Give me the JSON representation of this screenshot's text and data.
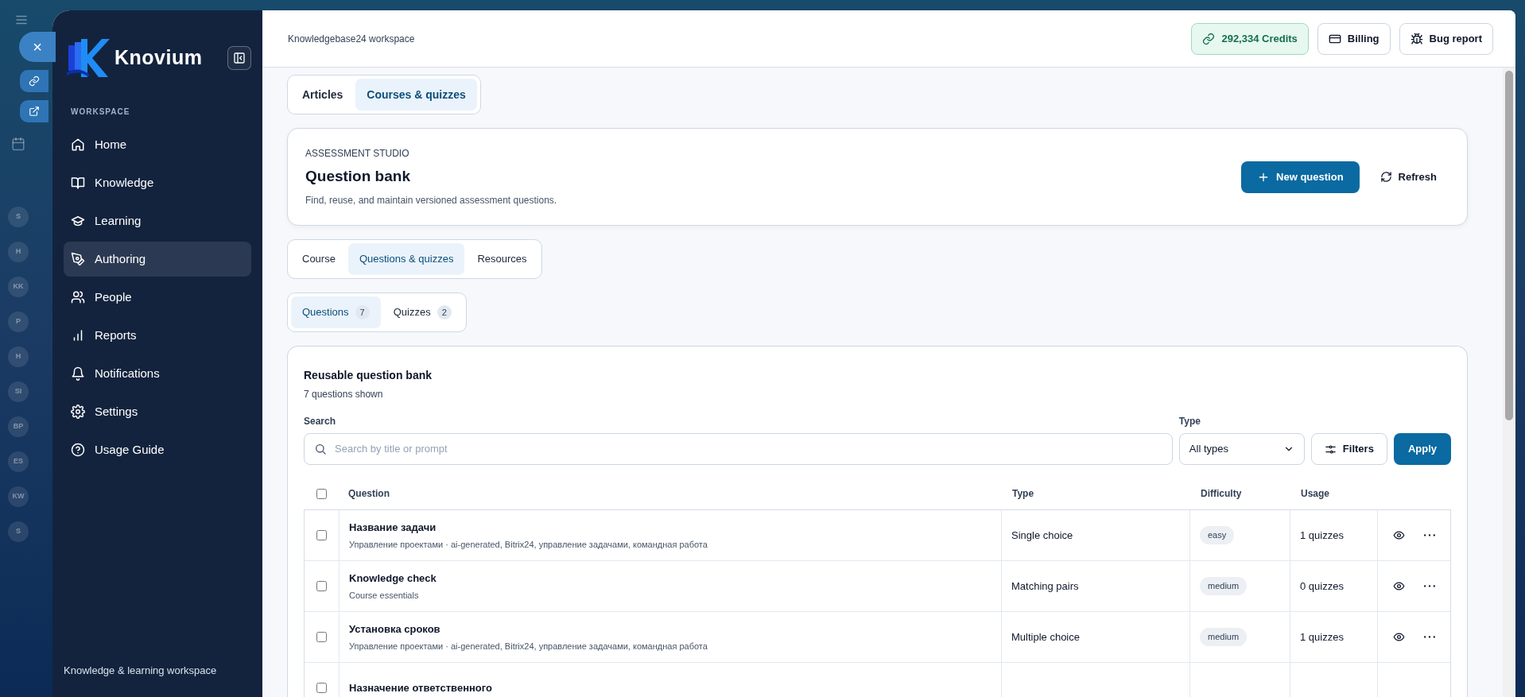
{
  "side_strip": {
    "close": "×",
    "avatars": [
      "S",
      "H",
      "KK",
      "P",
      "H",
      "SI",
      "BP",
      "ES",
      "KW",
      "S"
    ]
  },
  "sidebar": {
    "brand": "Knovium",
    "section": "WORKSPACE",
    "items": [
      {
        "label": "Home",
        "selected": false
      },
      {
        "label": "Knowledge",
        "selected": false
      },
      {
        "label": "Learning",
        "selected": false
      },
      {
        "label": "Authoring",
        "selected": true
      },
      {
        "label": "People",
        "selected": false
      },
      {
        "label": "Reports",
        "selected": false
      },
      {
        "label": "Notifications",
        "selected": false
      },
      {
        "label": "Settings",
        "selected": false
      },
      {
        "label": "Usage Guide",
        "selected": false
      }
    ],
    "footer": "Knowledge & learning workspace"
  },
  "header": {
    "workspace": "Knowledgebase24 workspace",
    "actions": [
      {
        "kind": "credits",
        "label": "292,334 Credits"
      },
      {
        "kind": "billing",
        "label": "Billing"
      },
      {
        "kind": "bug",
        "label": "Bug report"
      }
    ]
  },
  "top_tabs": [
    {
      "label": "Articles",
      "selected": false
    },
    {
      "label": "Courses & quizzes",
      "selected": true
    }
  ],
  "studio": {
    "eyebrow": "ASSESSMENT STUDIO",
    "title": "Question bank",
    "subtitle": "Find, reuse, and maintain versioned assessment questions.",
    "primary": "New question",
    "secondary": "Refresh"
  },
  "section_tabs": [
    {
      "label": "Course",
      "selected": false
    },
    {
      "label": "Questions & quizzes",
      "selected": true
    },
    {
      "label": "Resources",
      "selected": false
    }
  ],
  "bank_tabs": [
    {
      "label": "Questions",
      "count": "7",
      "selected": true
    },
    {
      "label": "Quizzes",
      "count": "2",
      "selected": false
    }
  ],
  "bank": {
    "title": "Reusable question bank",
    "subtitle": "7 questions shown",
    "search_label": "Search",
    "search_placeholder": "Search by title or prompt",
    "type_label": "Type",
    "type_value": "All types",
    "filters": "Filters",
    "apply": "Apply",
    "columns": [
      "Question",
      "Type",
      "Difficulty",
      "Usage"
    ],
    "select_all": false,
    "rows": [
      {
        "title": "Название задачи",
        "meta": "Управление проектами · ai-generated, Bitrix24, управление задачами, командная работа",
        "type": "Single choice",
        "difficulty": "easy",
        "usage": "1 quizzes",
        "selected": false
      },
      {
        "title": "Knowledge check",
        "meta": "Course essentials",
        "type": "Matching pairs",
        "difficulty": "medium",
        "usage": "0 quizzes",
        "selected": false
      },
      {
        "title": "Установка сроков",
        "meta": "Управление проектами · ai-generated, Bitrix24, управление задачами, командная работа",
        "type": "Multiple choice",
        "difficulty": "medium",
        "usage": "1 quizzes",
        "selected": false
      },
      {
        "title": "Назначение ответственного",
        "selected": false
      }
    ]
  }
}
